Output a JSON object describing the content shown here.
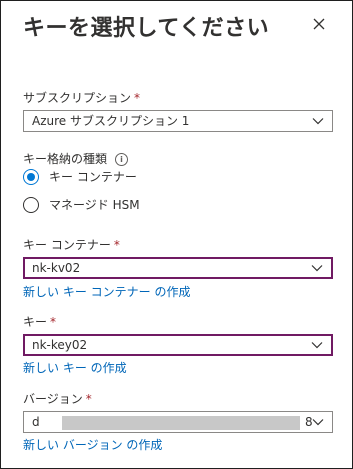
{
  "panel": {
    "title": "キーを選択してください"
  },
  "subscription": {
    "label": "サブスクリプション",
    "required_mark": "*",
    "value": "Azure サブスクリプション 1"
  },
  "key_store_type": {
    "label": "キー格納の種類",
    "info_icon": "i",
    "options": [
      {
        "label": "キー コンテナー",
        "selected": true
      },
      {
        "label": "マネージド HSM",
        "selected": false
      }
    ]
  },
  "key_vault": {
    "label": "キー コンテナー",
    "required_mark": "*",
    "value": "nk-kv02",
    "create_link": "新しい キー コンテナー の作成"
  },
  "key": {
    "label": "キー",
    "required_mark": "*",
    "value": "nk-key02",
    "create_link": "新しい キー の作成"
  },
  "version": {
    "label": "バージョン",
    "required_mark": "*",
    "value_start": "d",
    "value_end": "8",
    "create_link": "新しい バージョン の作成"
  },
  "colors": {
    "accent_link": "#0066b8",
    "radio_selected": "#0078d4",
    "required": "#a4262c",
    "active_border": "#701a63"
  },
  "icons": {
    "close": "close-icon",
    "dropdown": "chevron-down-icon",
    "info": "info-icon"
  }
}
